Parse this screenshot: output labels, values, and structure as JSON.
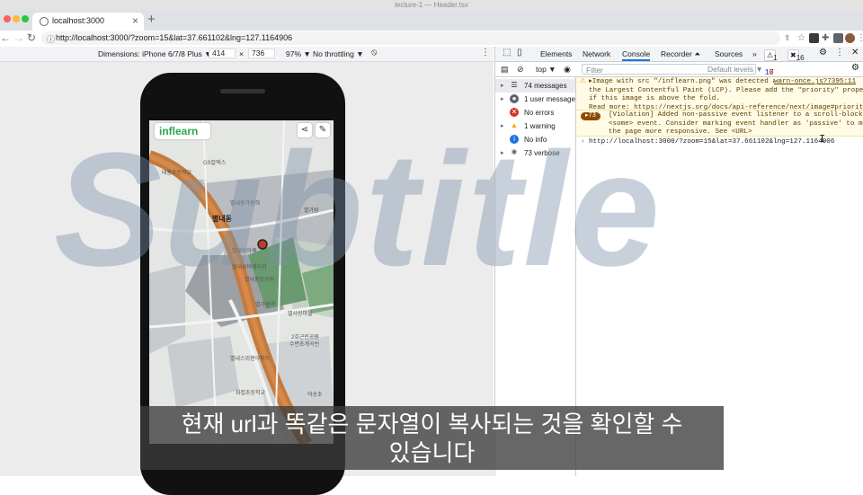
{
  "window": {
    "title": "lecture-1 — Header.tsx"
  },
  "browser": {
    "tab_title": "localhost:3000",
    "url": "http://localhost:3000/?zoom=15&lat=37.661102&lng=127.1164906",
    "nav": {
      "back": "←",
      "forward": "→",
      "reload": "↻"
    }
  },
  "emulation": {
    "dimensions_label": "Dimensions: iPhone 6/7/8 Plus ▼",
    "width": "414",
    "times": "×",
    "height": "736",
    "zoom": "97% ▼",
    "throttle": "No throttling ▼"
  },
  "app": {
    "logo_text": "inflearn",
    "share_icon": "share-icon",
    "feedback_icon": "feedback-icon",
    "map_labels": [
      "GS칼텍스",
      "태홍초등학교",
      "별내동",
      "별내동가람혀",
      "별가람",
      "별내이아페",
      "별내위버레이리",
      "별내중앙공원",
      "별가람역",
      "별사랑마을",
      "2호근린공원",
      "수변초계곡빈",
      "별내스위첸아파트",
      "화접초등학교",
      "덕송초"
    ]
  },
  "devtools": {
    "tabs": [
      "Elements",
      "Network",
      "Console",
      "Recorder ⏶",
      "Sources",
      "»"
    ],
    "active_tab": "Console",
    "warn_badge": "1",
    "error_badge": "16",
    "info_badge": "1",
    "context": "top ▼",
    "filter_placeholder": "Filter",
    "levels": "Default levels ▼",
    "issues": "17 Issues:",
    "issues_err": "16",
    "issues_info": "1",
    "sidebar": [
      {
        "label": "74 messages",
        "icon": "list-icon"
      },
      {
        "label": "1 user message",
        "icon": "user-icon"
      },
      {
        "label": "No errors",
        "icon": "error-icon"
      },
      {
        "label": "1 warning",
        "icon": "warning-icon"
      },
      {
        "label": "No info",
        "icon": "info-icon"
      },
      {
        "label": "73 verbose",
        "icon": "bug-icon"
      }
    ],
    "warning_message": "▸Image with src \"/inflearn.png\" was detected as\nthe Largest Contentful Paint (LCP). Please add the \"priority\" property\nif this image is above the fold.\nRead more: https://nextjs.org/docs/api-reference/next/image#priority",
    "warning_source": "warn-once.js?7395:11",
    "violation_count": "73",
    "violation_message": "[Violation] Added non-passive event listener to a scroll-blocking\n<some> event. Consider marking event handler as 'passive' to make\nthe page more responsive. See <URL>",
    "output_line": "http://localhost:3000/?zoom=15&lat=37.661102&lng=127.1164906"
  },
  "overlay": {
    "watermark": "Subtitle",
    "subtitle_line1": "현재 url과 똑같은 문자열이 복사되는 것을 확인할 수",
    "subtitle_line2": "있습니다"
  }
}
